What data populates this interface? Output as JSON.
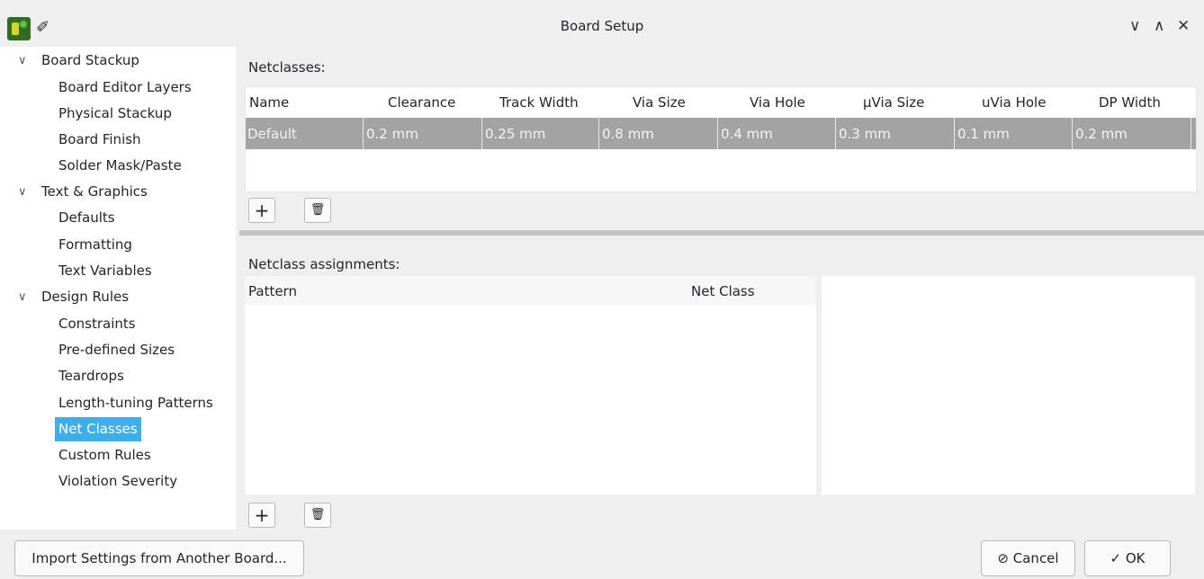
{
  "window": {
    "title": "Board Setup",
    "icons": [
      "kicad-pcb-app-icon",
      "pin-icon"
    ],
    "controls": [
      "∨",
      "∧",
      "✕"
    ]
  },
  "sidebar": {
    "groups": [
      {
        "label": "Board Stackup",
        "items": [
          "Board Editor Layers",
          "Physical Stackup",
          "Board Finish",
          "Solder Mask/Paste"
        ]
      },
      {
        "label": "Text & Graphics",
        "items": [
          "Defaults",
          "Formatting",
          "Text Variables"
        ]
      },
      {
        "label": "Design Rules",
        "items": [
          "Constraints",
          "Pre-defined Sizes",
          "Teardrops",
          "Length-tuning Patterns",
          "Net Classes",
          "Custom Rules",
          "Violation Severity"
        ]
      }
    ],
    "selected": "Net Classes",
    "accent": "#3daee9"
  },
  "netclasses": {
    "label": "Netclasses:",
    "columns": [
      "Name",
      "Clearance",
      "Track Width",
      "Via Size",
      "Via Hole",
      "μVia Size",
      "uVia Hole",
      "DP Width"
    ],
    "rows": [
      [
        "Default",
        "0.2 mm",
        "0.25 mm",
        "0.8 mm",
        "0.4 mm",
        "0.3 mm",
        "0.1 mm",
        "0.2 mm"
      ]
    ],
    "add_symbol": "+",
    "delete_symbol": "🗑"
  },
  "assignments": {
    "label": "Netclass assignments:",
    "columns": [
      "Pattern",
      "Net Class"
    ],
    "add_symbol": "+",
    "delete_symbol": "🗑"
  },
  "footer": {
    "import_label": "Import Settings from Another Board...",
    "cancel_label": "Cancel",
    "cancel_icon": "⃠",
    "ok_label": "OK",
    "ok_icon": "✓"
  }
}
